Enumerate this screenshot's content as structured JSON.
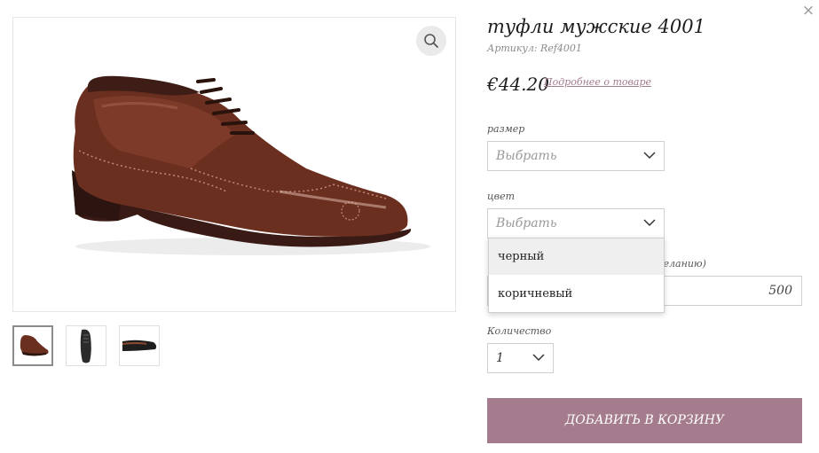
{
  "product": {
    "title": "туфли мужские 4001",
    "sku": "Артикул: Ref4001",
    "price": "€44.20",
    "more_link": "Подробнее о товаре"
  },
  "size": {
    "label": "размер",
    "value": "Выбрать"
  },
  "color": {
    "label": "цвет",
    "value": "Выбрать",
    "options": [
      "черный",
      "коричневый"
    ],
    "highlighted": "черный"
  },
  "extra": {
    "label_visible": "желанию)",
    "value": "500"
  },
  "quantity": {
    "label": "Количество",
    "value": "1"
  },
  "cart_button": "ДОБАВИТЬ В КОРЗИНУ",
  "close_glyph": "×",
  "colors": {
    "accent": "#a47c8e",
    "link": "#a27b8e",
    "shoe": "#6b2f20"
  },
  "icons": [
    "close-icon",
    "search-icon",
    "chevron-down-icon"
  ]
}
